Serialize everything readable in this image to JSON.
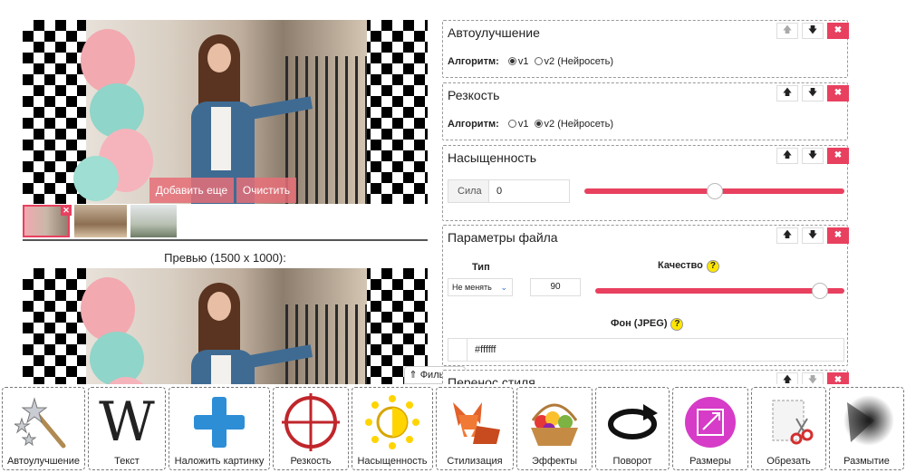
{
  "editor": {
    "add_more_label": "Добавить еще",
    "clear_label": "Очистить",
    "preview_label": "Превью (1500 x 1000):",
    "filters_label": "⇑ Фильтры ⇑"
  },
  "panels": {
    "autoenhance": {
      "title": "Автоулучшение",
      "algo_label": "Алгоритм:",
      "opt1": "v1",
      "opt2": "v2 (Нейросеть)",
      "selected": "v1"
    },
    "sharpness": {
      "title": "Резкость",
      "algo_label": "Алгоритм:",
      "opt1": "v1",
      "opt2": "v2 (Нейросеть)",
      "selected": "v2"
    },
    "saturation": {
      "title": "Насыщенность",
      "strength_label": "Сила",
      "strength_value": "0",
      "slider_level": 0.5
    },
    "file_params": {
      "title": "Параметры файла",
      "type_label": "Тип",
      "type_value": "Не менять",
      "quality_label": "Качество",
      "quality_value": "90",
      "quality_level": 0.9,
      "bg_label": "Фон (JPEG)",
      "bg_value": "#ffffff",
      "help": "?"
    },
    "style_transfer": {
      "title": "Перенос стиля"
    }
  },
  "controls": {
    "up": "🡅",
    "down": "🡇",
    "delete": "✖"
  },
  "tools": [
    {
      "label": "Автоулучшение",
      "icon": "magic-wand-icon"
    },
    {
      "label": "Текст",
      "icon": "text-w-icon",
      "glyph": "W"
    },
    {
      "label": "Наложить картинку",
      "icon": "plus-icon"
    },
    {
      "label": "Резкость",
      "icon": "crosshair-icon"
    },
    {
      "label": "Насыщенность",
      "icon": "sun-icon"
    },
    {
      "label": "Стилизация",
      "icon": "fox-icon"
    },
    {
      "label": "Эффекты",
      "icon": "fruit-basket-icon"
    },
    {
      "label": "Поворот",
      "icon": "rotate-icon"
    },
    {
      "label": "Размеры",
      "icon": "resize-icon"
    },
    {
      "label": "Обрезать",
      "icon": "crop-scissors-icon"
    },
    {
      "label": "Размытие",
      "icon": "blur-icon"
    }
  ],
  "colors": {
    "accent": "#e8405f",
    "help": "#ffe600"
  }
}
